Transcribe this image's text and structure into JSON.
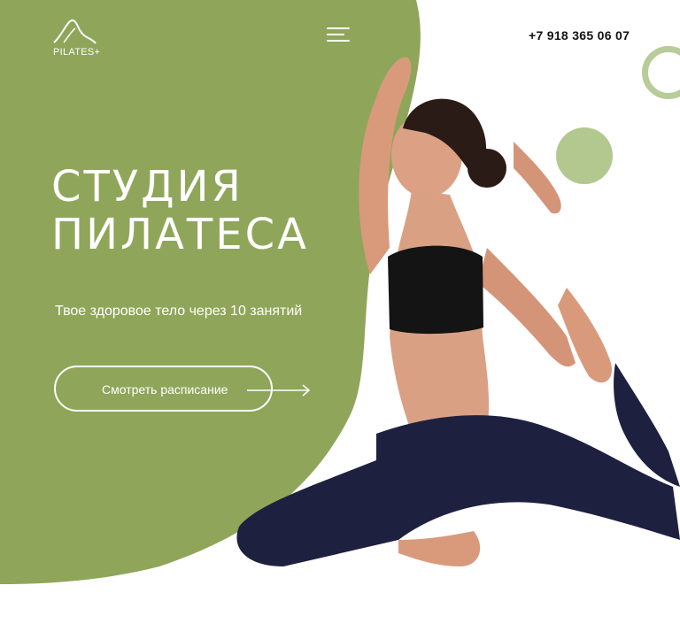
{
  "header": {
    "logo_text": "PILATES+",
    "phone": "+7 918 365 06 07",
    "menu_icon": "hamburger-icon"
  },
  "hero": {
    "title_line1": "СТУДИЯ",
    "title_line2": "ПИЛАТЕСА",
    "subtitle": "Твое здоровое тело через 10 занятий",
    "cta_label": "Смотреть расписание",
    "cta_icon": "arrow-right-icon"
  },
  "colors": {
    "accent_green": "#8fa65a",
    "light_green": "#b2c88f",
    "text_dark": "#111111"
  }
}
